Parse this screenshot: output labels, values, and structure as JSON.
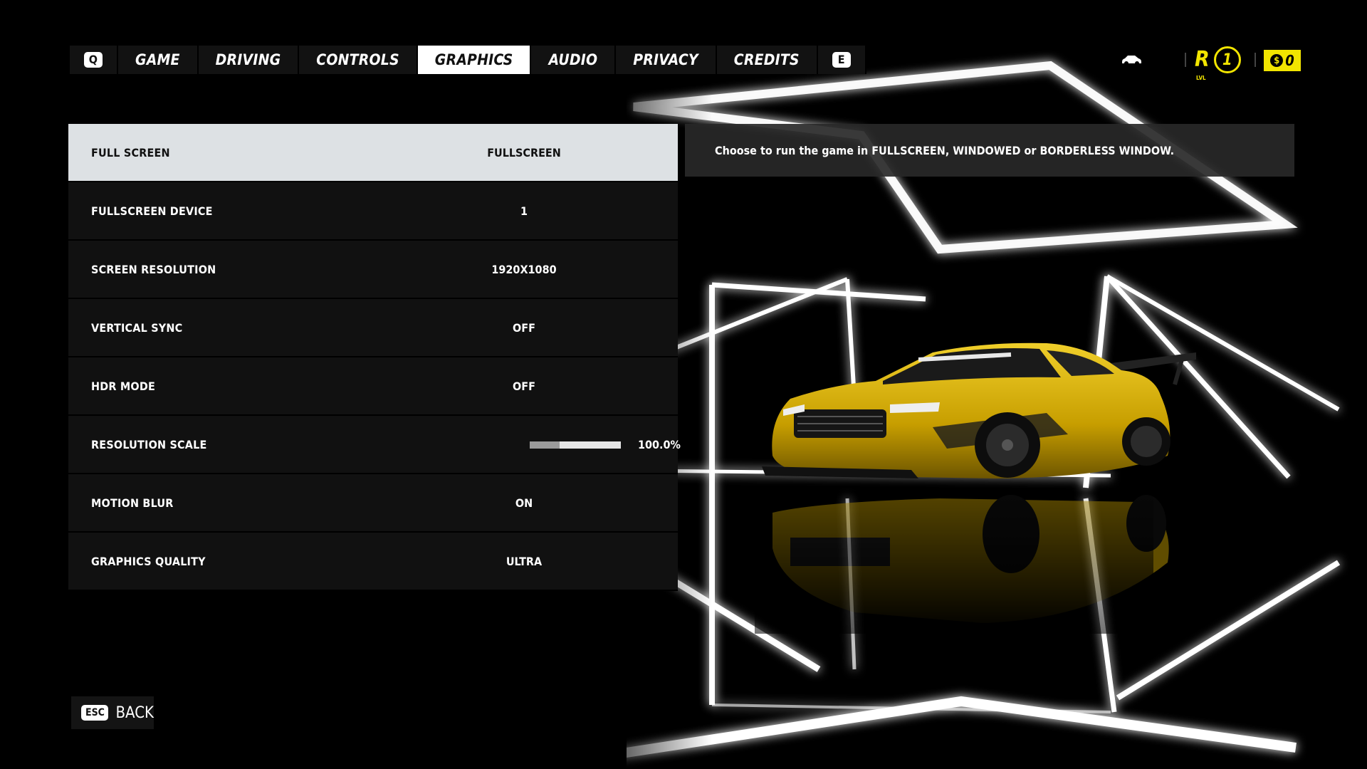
{
  "tabs": {
    "left_key": "Q",
    "right_key": "E",
    "items": [
      {
        "label": "GAME"
      },
      {
        "label": "DRIVING"
      },
      {
        "label": "CONTROLS"
      },
      {
        "label": "GRAPHICS"
      },
      {
        "label": "AUDIO"
      },
      {
        "label": "PRIVACY"
      },
      {
        "label": "CREDITS"
      }
    ],
    "active": "GRAPHICS"
  },
  "hud": {
    "car_icon": "car-icon",
    "rank_letter": "R",
    "rank_sub": "LVL",
    "level": "1",
    "currency_symbol": "$",
    "money": "0"
  },
  "settings": [
    {
      "label": "FULL SCREEN",
      "value": "FULLSCREEN",
      "selected": true
    },
    {
      "label": "FULLSCREEN DEVICE",
      "value": "1"
    },
    {
      "label": "SCREEN RESOLUTION",
      "value": "1920X1080"
    },
    {
      "label": "VERTICAL SYNC",
      "value": "OFF"
    },
    {
      "label": "HDR MODE",
      "value": "OFF"
    },
    {
      "label": "RESOLUTION SCALE",
      "value": "100.0%",
      "slider_fraction": 0.33
    },
    {
      "label": "MOTION BLUR",
      "value": "ON"
    },
    {
      "label": "GRAPHICS QUALITY",
      "value": "ULTRA"
    }
  ],
  "description": "Choose to run the game in FULLSCREEN, WINDOWED or BORDERLESS WINDOW.",
  "footer": {
    "back_key": "ESC",
    "back_label": "BACK"
  },
  "colors": {
    "accent": "#f2e500",
    "row_bg": "#111111",
    "row_selected_bg": "#dde1e4",
    "car_body": "#d9b400"
  }
}
